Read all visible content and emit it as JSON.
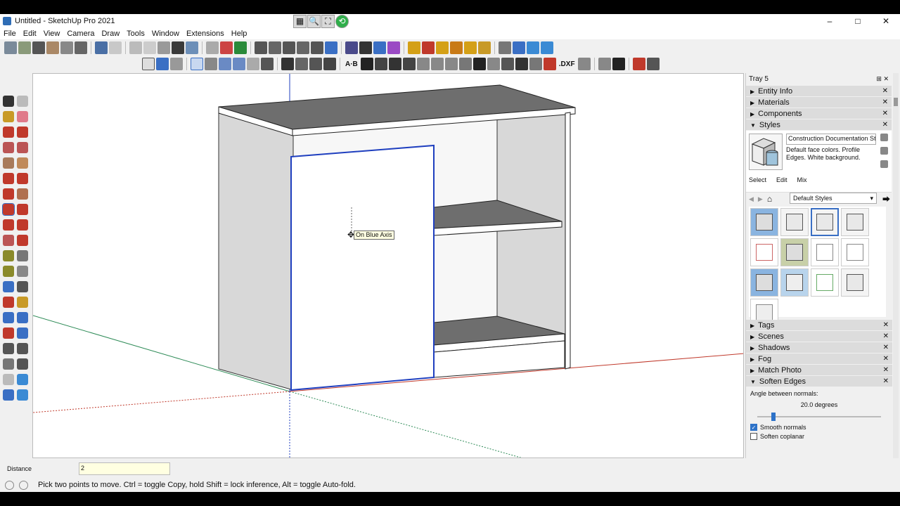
{
  "window": {
    "title": "Untitled - SketchUp Pro 2021",
    "controls": [
      "–",
      "□",
      "✕"
    ]
  },
  "quick_access": [
    "▦",
    "🔍",
    "⛶",
    "⟲"
  ],
  "menubar": [
    "File",
    "Edit",
    "View",
    "Camera",
    "Draw",
    "Tools",
    "Window",
    "Extensions",
    "Help"
  ],
  "toolbar2_text": {
    "ab": "A·B",
    "dxf": ".DXF"
  },
  "viewport": {
    "tooltip": "On Blue Axis",
    "colors": {
      "red_axis": "#c0392b",
      "green_axis": "#2e8b57",
      "blue_axis": "#1f3fbf",
      "face_top": "#6e6e6e",
      "face_side": "#d8d8d8",
      "face_front": "#ffffff",
      "selection": "#1f3fbf"
    }
  },
  "tray": {
    "title": "Tray 5",
    "pin": "⊞ ✕",
    "panels_top": [
      {
        "label": "Entity Info",
        "arrow": "▶",
        "close": "✕"
      },
      {
        "label": "Materials",
        "arrow": "▶",
        "close": "✕"
      },
      {
        "label": "Components",
        "arrow": "▶",
        "close": "✕"
      },
      {
        "label": "Styles",
        "arrow": "▼",
        "close": "✕"
      }
    ],
    "styles": {
      "name": "Construction Documentation Styl",
      "description": "Default face colors. Profile Edges. White background.",
      "tabs": [
        "Select",
        "Edit",
        "Mix"
      ],
      "collection": "Default Styles",
      "nav": {
        "back": "◀",
        "forward": "▶",
        "home": "⌂",
        "menu": "⮕"
      }
    },
    "panels_bottom": [
      {
        "label": "Tags",
        "arrow": "▶",
        "close": "✕"
      },
      {
        "label": "Scenes",
        "arrow": "▶",
        "close": "✕"
      },
      {
        "label": "Shadows",
        "arrow": "▶",
        "close": "✕"
      },
      {
        "label": "Fog",
        "arrow": "▶",
        "close": "✕"
      },
      {
        "label": "Match Photo",
        "arrow": "▶",
        "close": "✕"
      },
      {
        "label": "Soften Edges",
        "arrow": "▼",
        "close": "✕"
      }
    ],
    "soften": {
      "angle_label": "Angle between normals:",
      "angle_value": "20.0  degrees",
      "angle_fraction": 0.12,
      "smooth_normals": "Smooth normals",
      "smooth_checked": "✓",
      "soften_coplanar": "Soften coplanar"
    }
  },
  "vcb": {
    "label": "Distance",
    "value": "2"
  },
  "status": {
    "text": "Pick two points to move.  Ctrl = toggle Copy, hold Shift = lock inference, Alt = toggle Auto-fold."
  }
}
